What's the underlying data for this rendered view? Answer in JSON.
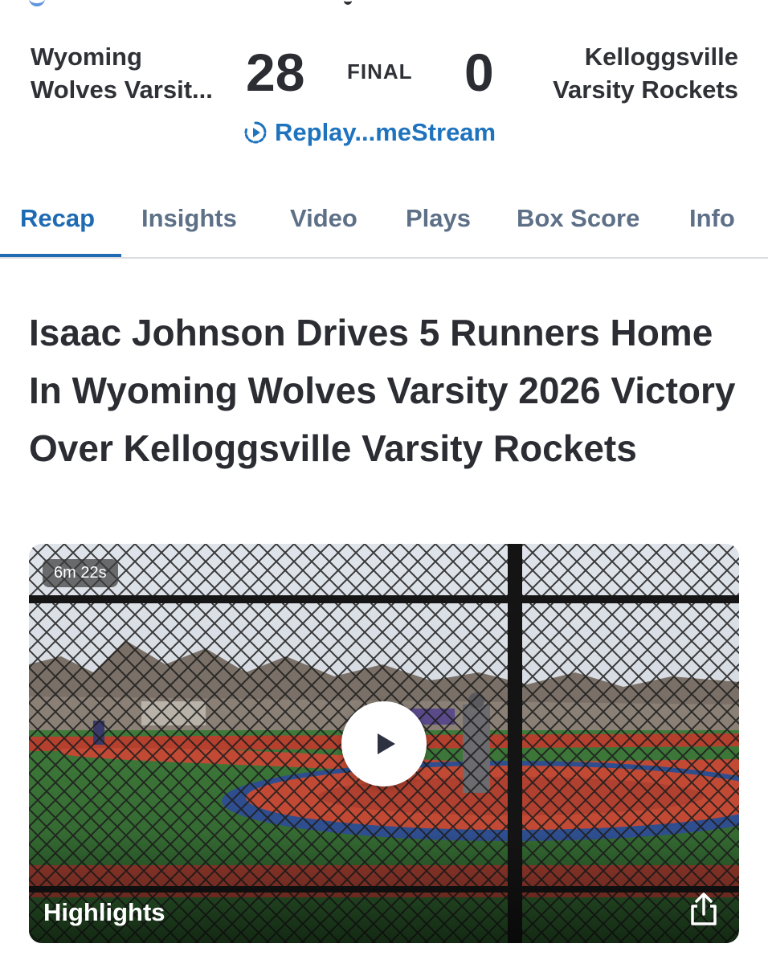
{
  "game": {
    "home_team": "Wyoming\nWolves Varsit...",
    "away_team": "Kelloggsville\nVarsity Rockets",
    "home_score": "28",
    "away_score": "0",
    "status": "FINAL",
    "replay_label": "Replay...meStream"
  },
  "tabs": [
    {
      "label": "Recap"
    },
    {
      "label": "Insights"
    },
    {
      "label": "Video"
    },
    {
      "label": "Plays"
    },
    {
      "label": "Box Score"
    },
    {
      "label": "Info"
    }
  ],
  "active_tab": "Recap",
  "article": {
    "headline": "Isaac Johnson Drives 5 Runners Home In Wyoming Wolves Varsity 2026 Victory Over Kelloggsville Varsity Rockets"
  },
  "video": {
    "duration": "6m 22s",
    "label": "Highlights"
  },
  "icons": {
    "replay": "replay-icon",
    "play": "play-icon",
    "share": "share-icon"
  },
  "colors": {
    "accent": "#1e6bb3",
    "link": "#1e73be",
    "tab_inactive": "#5d7087",
    "text": "#2b2d33"
  }
}
